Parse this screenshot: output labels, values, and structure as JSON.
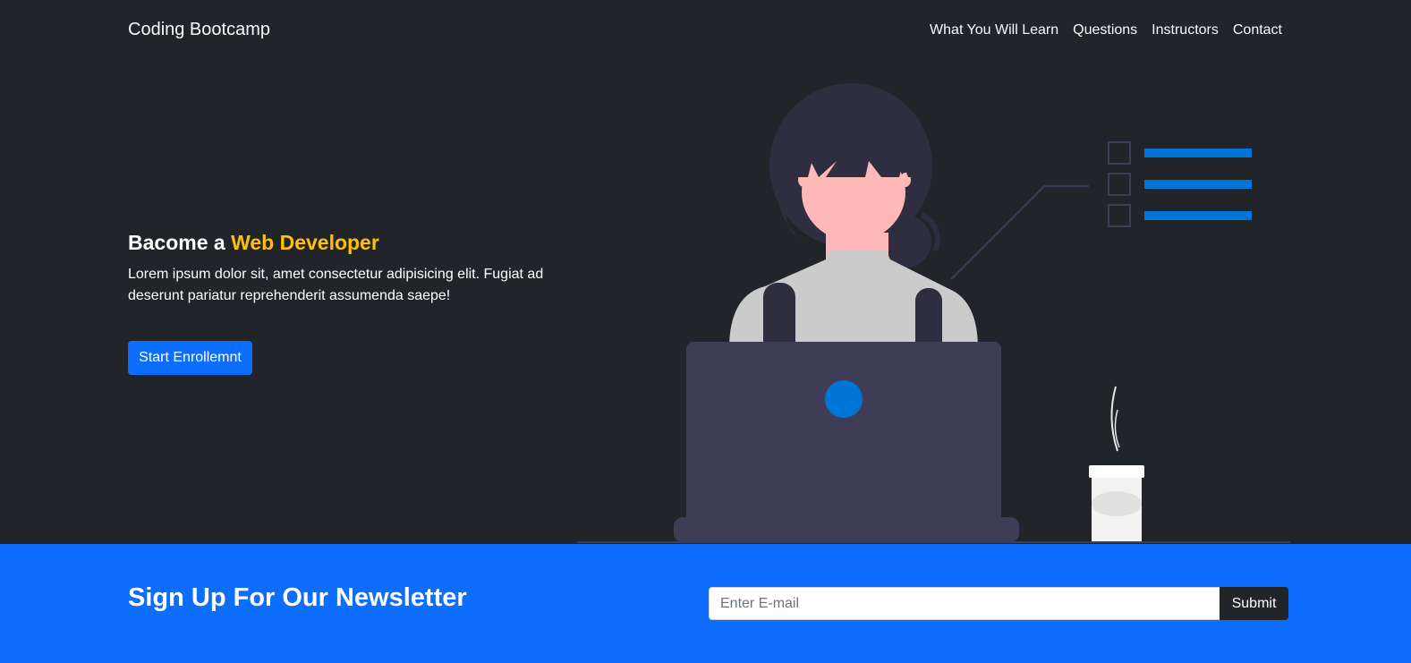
{
  "navbar": {
    "brand": "Coding Bootcamp",
    "links": [
      "What You Will Learn",
      "Questions",
      "Instructors",
      "Contact"
    ]
  },
  "hero": {
    "title_prefix": "Bacome a ",
    "title_accent": "Web Developer",
    "description": "Lorem ipsum dolor sit, amet consectetur adipisicing elit. Fugiat ad deserunt pariatur reprehenderit assumenda saepe!",
    "button_label": "Start Enrollemnt",
    "illustration_icon": "developer-at-laptop-illustration"
  },
  "newsletter": {
    "title": "Sign Up For Our Newsletter",
    "email_placeholder": "Enter E-mail",
    "email_value": "",
    "submit_label": "Submit"
  },
  "colors": {
    "background": "#212529",
    "primary": "#0d6efd",
    "accent": "#ffc107",
    "illustration_blue": "#0075d8",
    "laptop": "#3f3d56"
  }
}
